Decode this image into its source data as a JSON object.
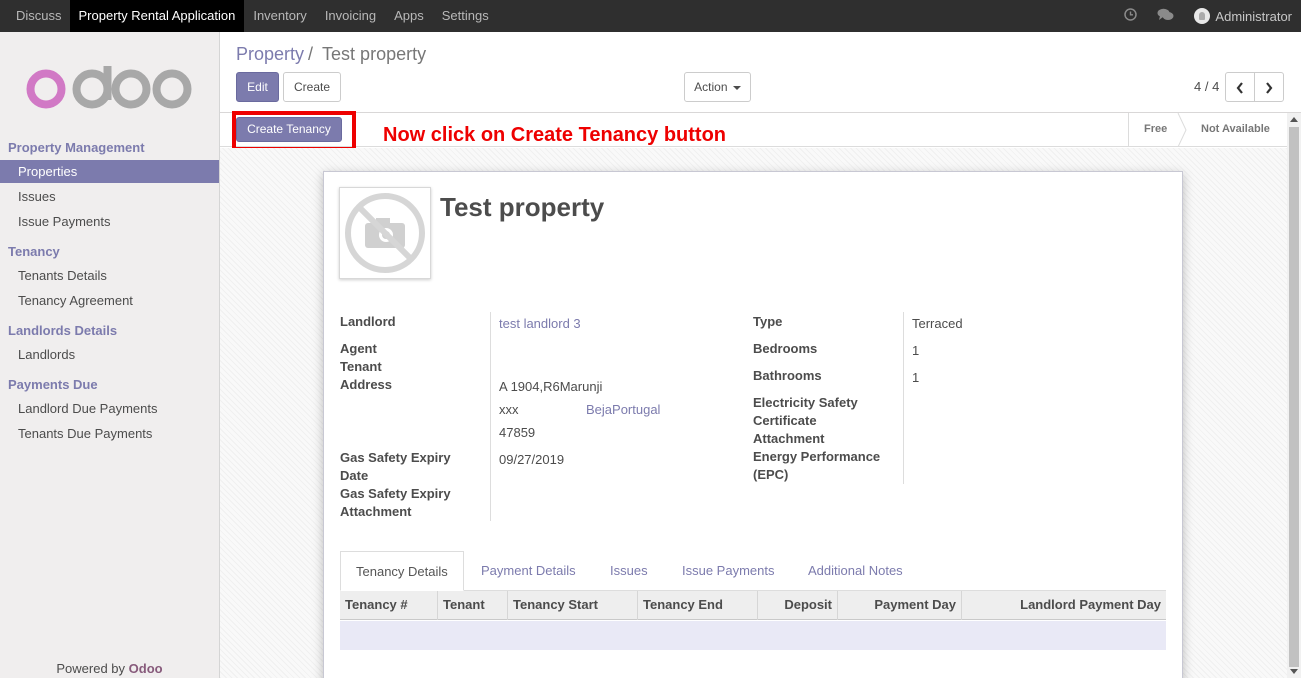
{
  "topbar": {
    "menu": [
      "Discuss",
      "Property Rental Application",
      "Inventory",
      "Invoicing",
      "Apps",
      "Settings"
    ],
    "user": "Administrator"
  },
  "sidebar": {
    "logo": "odoo",
    "sections": [
      {
        "title": "Property Management",
        "items": [
          "Properties",
          "Issues",
          "Issue Payments"
        ]
      },
      {
        "title": "Tenancy",
        "items": [
          "Tenants Details",
          "Tenancy Agreement"
        ]
      },
      {
        "title": "Landlords Details",
        "items": [
          "Landlords"
        ]
      },
      {
        "title": "Payments Due",
        "items": [
          "Landlord Due Payments",
          "Tenants Due Payments"
        ]
      }
    ],
    "powered_prefix": "Powered by",
    "powered_brand": "Odoo"
  },
  "control_panel": {
    "breadcrumb_parent": "Property",
    "breadcrumb_sep": "/",
    "breadcrumb_current": "Test property",
    "edit_label": "Edit",
    "create_label": "Create",
    "action_label": "Action",
    "pager": "4 / 4"
  },
  "statusbar": {
    "create_tenancy_label": "Create Tenancy",
    "annotation": "Now click on Create Tenancy button",
    "stages": [
      "Free",
      "Not Available"
    ]
  },
  "form": {
    "title": "Test property",
    "left": {
      "landlord_label": "Landlord",
      "landlord_value": "test landlord 3",
      "agent_label": "Agent",
      "tenant_label": "Tenant",
      "address_label": "Address",
      "address_line1": "A 1904,R6Marunji",
      "address_city": "xxx",
      "address_state_country": "BejaPortugal",
      "address_zip": "47859",
      "gas_expiry_label_1": "Gas Safety Expiry",
      "gas_expiry_label_2": "Date",
      "gas_expiry_value": "09/27/2019",
      "gas_attach_label_1": "Gas Safety Expiry",
      "gas_attach_label_2": "Attachment"
    },
    "right": {
      "type_label": "Type",
      "type_value": "Terraced",
      "bedrooms_label": "Bedrooms",
      "bedrooms_value": "1",
      "bathrooms_label": "Bathrooms",
      "bathrooms_value": "1",
      "elec_label_1": "Electricity Safety",
      "elec_label_2": "Certificate",
      "elec_label_3": "Attachment",
      "epc_label_1": "Energy Performance",
      "epc_label_2": "(EPC)"
    },
    "tabs": [
      "Tenancy Details",
      "Payment Details",
      "Issues",
      "Issue Payments",
      "Additional Notes"
    ],
    "table_headers": [
      "Tenancy #",
      "Tenant",
      "Tenancy Start",
      "Tenancy End",
      "Deposit",
      "Payment Day",
      "Landlord Payment Day"
    ]
  },
  "colors": {
    "accent": "#7c7bad",
    "annotation": "#ee0000",
    "topbar": "#2f2f2f"
  },
  "icons": [
    "clock-icon",
    "chat-icon",
    "avatar-icon",
    "caret-down-icon",
    "chevron-left-icon",
    "chevron-right-icon",
    "no-image-icon"
  ]
}
